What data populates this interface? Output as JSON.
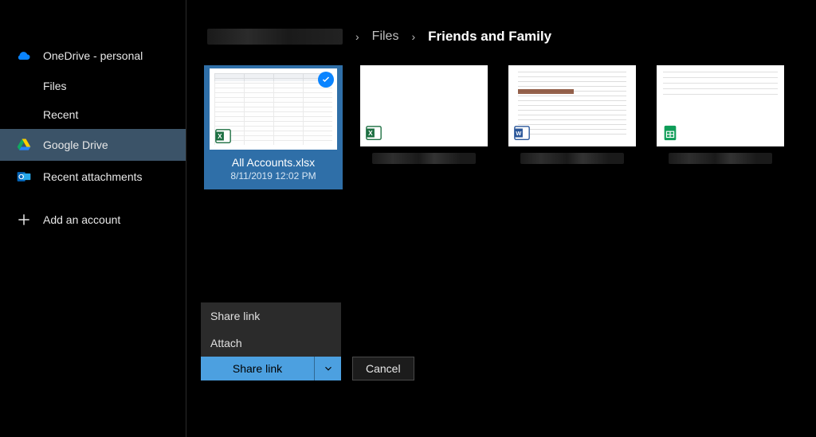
{
  "sidebar": {
    "items": [
      {
        "id": "onedrive",
        "label": "OneDrive - personal",
        "icon": "cloud-icon"
      },
      {
        "id": "files",
        "label": "Files",
        "sub": true
      },
      {
        "id": "recent",
        "label": "Recent",
        "sub": true
      },
      {
        "id": "gdrive",
        "label": "Google Drive",
        "icon": "gdrive-icon",
        "selected": true
      },
      {
        "id": "recent-attach",
        "label": "Recent attachments",
        "icon": "outlook-icon"
      },
      {
        "id": "add-account",
        "label": "Add an account",
        "icon": "plus-icon"
      }
    ]
  },
  "breadcrumbs": {
    "root_hidden": true,
    "link_label": "Files",
    "current": "Friends and Family"
  },
  "files": [
    {
      "name": "All Accounts.xlsx",
      "date": "8/11/2019 12:02 PM",
      "type": "excel",
      "selected": true
    },
    {
      "name": "",
      "type": "excel",
      "redacted": true
    },
    {
      "name": "",
      "type": "word",
      "redacted": true
    },
    {
      "name": "",
      "type": "sheets",
      "redacted": true
    }
  ],
  "menu": {
    "items": [
      {
        "label": "Share link"
      },
      {
        "label": "Attach"
      }
    ]
  },
  "buttons": {
    "primary": "Share link",
    "cancel": "Cancel"
  }
}
